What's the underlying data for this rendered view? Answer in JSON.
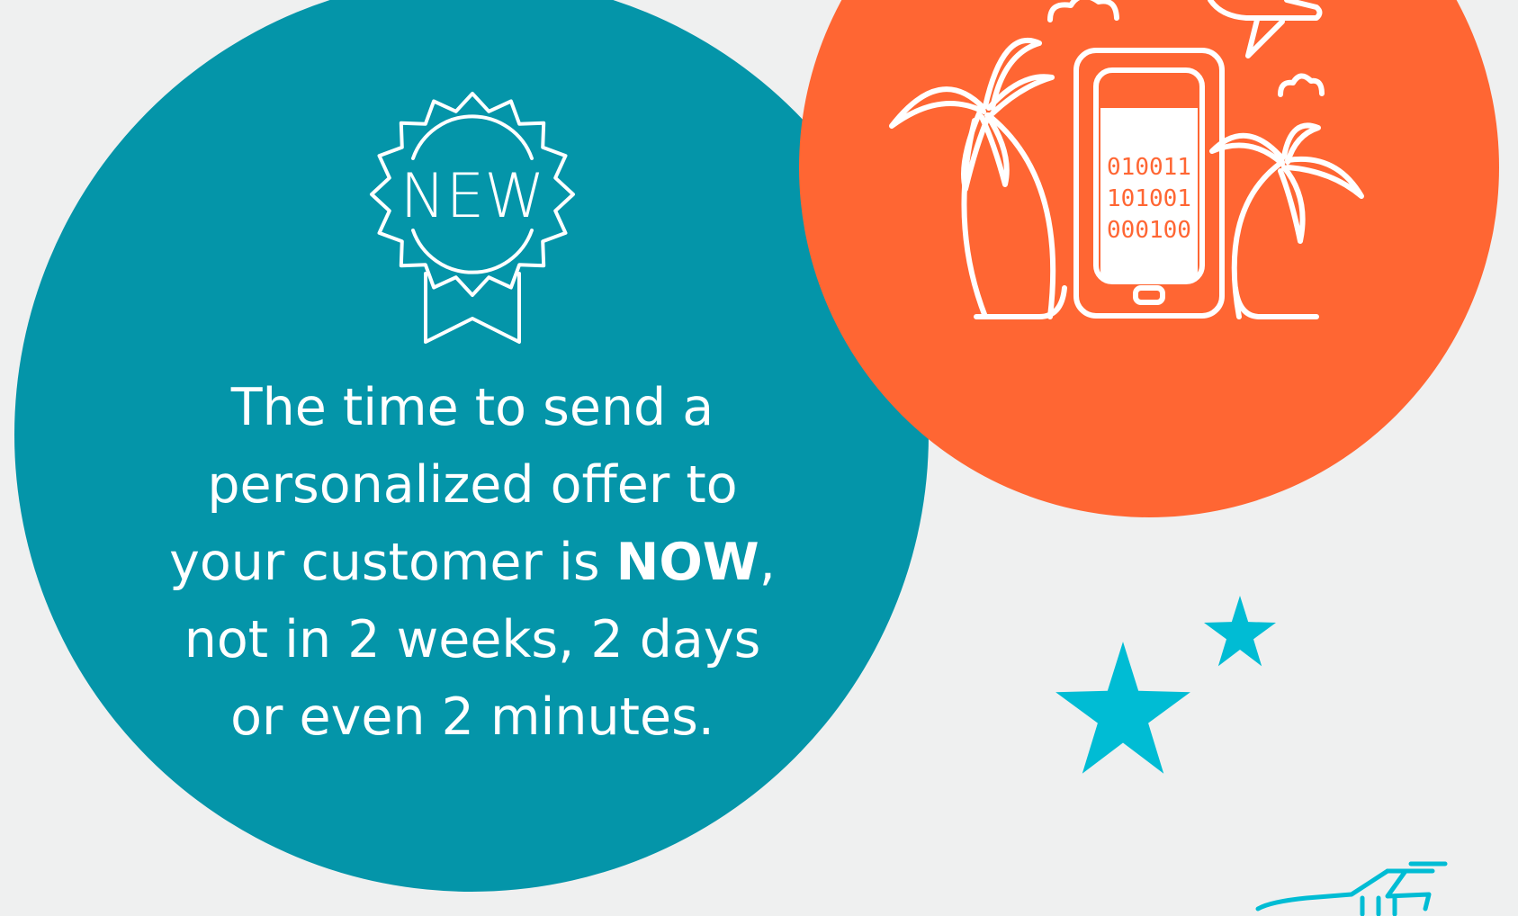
{
  "colors": {
    "background": "#eff0f0",
    "teal": "#0495a9",
    "orange": "#ff6633",
    "star": "#00bcd4",
    "text": "#ffffff"
  },
  "badge": {
    "label": "NEW"
  },
  "phone": {
    "binary_lines": [
      "010011",
      "101001",
      "000100"
    ]
  },
  "message": {
    "line1": "The time to send a",
    "line2": "personalized offer to",
    "line3_pre": "your customer is ",
    "line3_bold": "NOW",
    "line3_post": ",",
    "line4": "not in 2 weeks, 2 days",
    "line5": "or even 2 minutes."
  },
  "icons": [
    "new-badge-icon",
    "palm-tree-icon",
    "smartphone-icon",
    "airplane-icon",
    "cloud-icon",
    "star-icon"
  ]
}
